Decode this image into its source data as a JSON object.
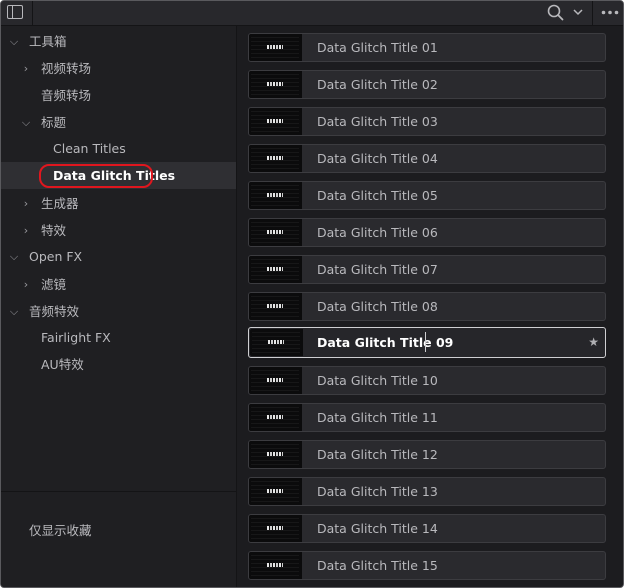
{
  "sidebar": {
    "items": [
      {
        "label": "工具箱",
        "chevron": "open"
      },
      {
        "label": "视频转场",
        "chevron": "closed"
      },
      {
        "label": "音频转场",
        "chevron": "none"
      },
      {
        "label": "标题",
        "chevron": "open"
      },
      {
        "label": "Clean Titles",
        "chevron": "none"
      },
      {
        "label": "Data Glitch Titles",
        "chevron": "none",
        "selected": true
      },
      {
        "label": "生成器",
        "chevron": "closed"
      },
      {
        "label": "特效",
        "chevron": "closed"
      },
      {
        "label": "Open FX",
        "chevron": "open"
      },
      {
        "label": "滤镜",
        "chevron": "closed"
      },
      {
        "label": "音频特效",
        "chevron": "open"
      },
      {
        "label": "Fairlight FX",
        "chevron": "none"
      },
      {
        "label": "AU特效",
        "chevron": "none"
      }
    ],
    "favorites_label": "仅显示收藏"
  },
  "list": {
    "items": [
      {
        "title": "Data Glitch Title 01"
      },
      {
        "title": "Data Glitch Title 02"
      },
      {
        "title": "Data Glitch Title 03"
      },
      {
        "title": "Data Glitch Title 04"
      },
      {
        "title": "Data Glitch Title 05"
      },
      {
        "title": "Data Glitch Title 06"
      },
      {
        "title": "Data Glitch Title 07"
      },
      {
        "title": "Data Glitch Title 08"
      },
      {
        "title": "Data Glitch Title 09",
        "selected": true
      },
      {
        "title": "Data Glitch Title 10"
      },
      {
        "title": "Data Glitch Title 11"
      },
      {
        "title": "Data Glitch Title 12"
      },
      {
        "title": "Data Glitch Title 13"
      },
      {
        "title": "Data Glitch Title 14"
      },
      {
        "title": "Data Glitch Title 15"
      }
    ]
  },
  "icons": {
    "panel_toggle": "sidebar-toggle-icon",
    "search": "search-icon",
    "dropdown": "chevron-down-icon",
    "more": "more-options-icon",
    "favorite": "star-icon"
  },
  "colors": {
    "background": "#1c1c1f",
    "selection_ring": "#e0161e"
  }
}
